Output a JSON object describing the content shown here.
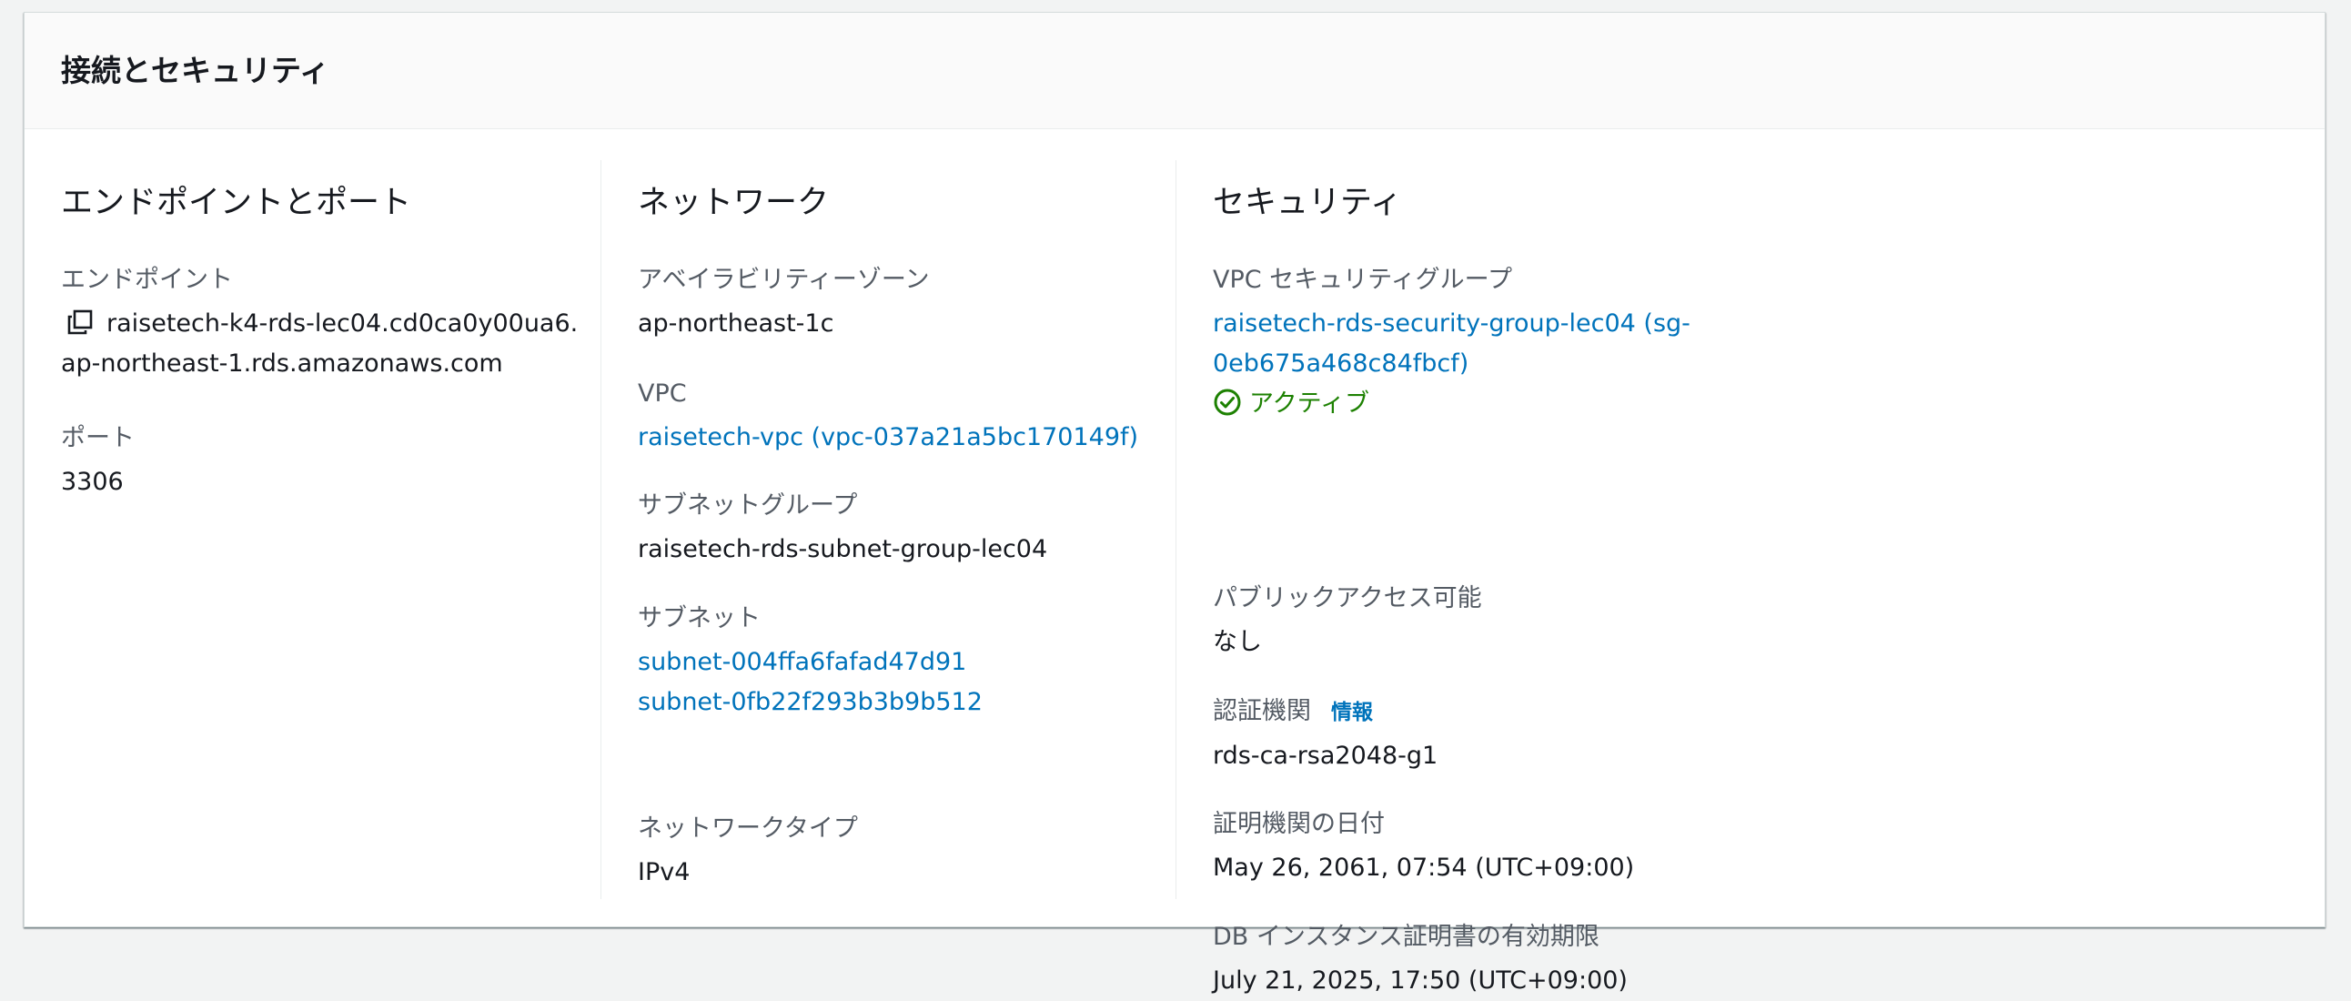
{
  "panel": {
    "title": "接続とセキュリティ"
  },
  "endpoint_port": {
    "title": "エンドポイントとポート",
    "endpoint_label": "エンドポイント",
    "endpoint_line1": "raisetech-k4-rds-lec04.cd0ca0y00ua6.",
    "endpoint_line2": "ap-northeast-1.rds.amazonaws.com",
    "port_label": "ポート",
    "port_value": "3306",
    "copy_icon": "copy-icon"
  },
  "network": {
    "title": "ネットワーク",
    "az_label": "アベイラビリティーゾーン",
    "az_value": "ap-northeast-1c",
    "vpc_label": "VPC",
    "vpc_value": "raisetech-vpc (vpc-037a21a5bc170149f)",
    "subnet_group_label": "サブネットグループ",
    "subnet_group_value": "raisetech-rds-subnet-group-lec04",
    "subnets_label": "サブネット",
    "subnets": [
      "subnet-004ffa6fafad47d91",
      "subnet-0fb22f293b3b9b512"
    ],
    "network_type_label": "ネットワークタイプ",
    "network_type_value": "IPv4"
  },
  "security": {
    "title": "セキュリティ",
    "sg_label": "VPC セキュリティグループ",
    "sg_link_line1": "raisetech-rds-security-group-lec04 (sg-",
    "sg_link_line2": "0eb675a468c84fbcf)",
    "sg_status": "アクティブ",
    "sg_status_icon": "check-circle-icon",
    "public_access_label": "パブリックアクセス可能",
    "public_access_value": "なし",
    "ca_label": "認証機関",
    "ca_info": "情報",
    "ca_value": "rds-ca-rsa2048-g1",
    "ca_date_label": "証明機関の日付",
    "ca_date_value": "May 26, 2061, 07:54 (UTC+09:00)",
    "cert_expiry_label": "DB インスタンス証明書の有効期限",
    "cert_expiry_value": "July 21, 2025, 17:50 (UTC+09:00)"
  },
  "colors": {
    "link": "#0073bb",
    "success": "#1d8102",
    "label": "#545b64",
    "text": "#16191f",
    "background": "#f2f3f3"
  }
}
